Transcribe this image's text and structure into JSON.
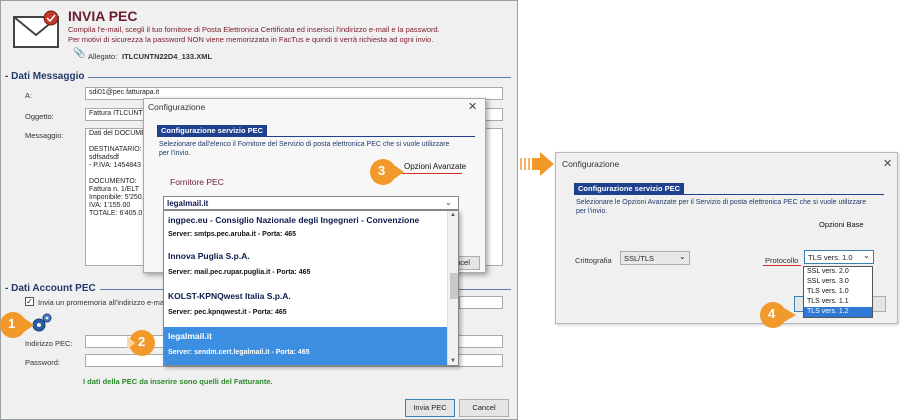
{
  "main_window": {
    "title": "INVIA PEC",
    "desc_line1": "Compila l'e-mail, scegli il tuo fornitore di Posta Elettronica Certificata ed inserisci l'indirizzo e-mail e la password.",
    "desc_line2": "Per motivi di sicurezza la password NON viene memorizzata in FacTus e quindi ti verrà richiesta ad ogni invio.",
    "attachment_label": "Allegato:",
    "attachment_file": "ITLCUNTN22D4_133.XML",
    "section_message": "- Dati Messaggio",
    "to_label": "A:",
    "to_value": "sdi01@pec.fatturapa.it",
    "subject_label": "Oggetto:",
    "subject_value": "Fattura ITLCUNT",
    "message_label": "Messaggio:",
    "message_lines": [
      "Dati del DOCUME",
      "",
      "DESTINATARIO:",
      "sdfsadsdf",
      " - P.IVA: 1454843",
      "",
      "DOCUMENTO:",
      "Fattura n. 1/ELT",
      "Imponibile: 5'250.",
      "IVA: 1'155.00",
      "TOTALE: 6'405.0"
    ],
    "section_account": "- Dati Account PEC",
    "reminder_label": "Invia un promemoria all'indirizzo e-mail",
    "pec_address_label": "Indirizzo PEC:",
    "password_label": "Password:",
    "note": "I dati della PEC da inserire sono quelli del Fatturante.",
    "send_button": "Invia PEC",
    "cancel_button": "Cancel"
  },
  "dialog1": {
    "title": "Configurazione",
    "panel_title": "Configurazione servizio PEC",
    "panel_text_line1": "Selezionare dall'elenco il Fornitore del Servizio di posta elettronica PEC che si vuole utilizzare",
    "panel_text_line2": "per l'invio.",
    "advanced_options": "Opzioni Avanzate",
    "provider_label": "Fornitore PEC",
    "selected_provider": "legalmail.it",
    "cancel_partial": "ncel",
    "providers": [
      {
        "name": "ingpec.eu - Consiglio Nazionale degli Ingegneri - Convenzione",
        "server": "Server: smtps.pec.aruba.it  -  Porta: 465"
      },
      {
        "name": "Innova Puglia S.p.A.",
        "server": "Server: mail.pec.rupar.puglia.it  -  Porta: 465"
      },
      {
        "name": "KOLST-KPNQwest Italia S.p.A.",
        "server": "Server: pec.kpnqwest.it  -  Porta: 465"
      },
      {
        "name": "legalmail.it",
        "server": "Server: sendm.cert.legalmail.it  -  Porta: 465"
      }
    ]
  },
  "dialog2": {
    "title": "Configurazione",
    "panel_title": "Configurazione servizio PEC",
    "panel_text_line1": "Selezionare le Opzioni Avanzate per il Servizio di posta elettronica PEC che si vuole utilizzare",
    "panel_text_line2": "per l'invio.",
    "base_options": "Opzioni Base",
    "encryption_label": "Crittografia",
    "encryption_value": "SSL/TLS",
    "protocol_label": "Protocollo",
    "protocol_value": "TLS vers. 1.0",
    "protocol_options": [
      "SSL vers. 2.0",
      "SSL vers. 3.0",
      "TLS vers. 1.0",
      "TLS vers. 1.1",
      "TLS vers. 1.2"
    ],
    "ok_partial": "",
    "cancel_partial": "ncel"
  },
  "badges": {
    "b1": "1",
    "b2": "2",
    "b3": "3",
    "b4": "4"
  }
}
